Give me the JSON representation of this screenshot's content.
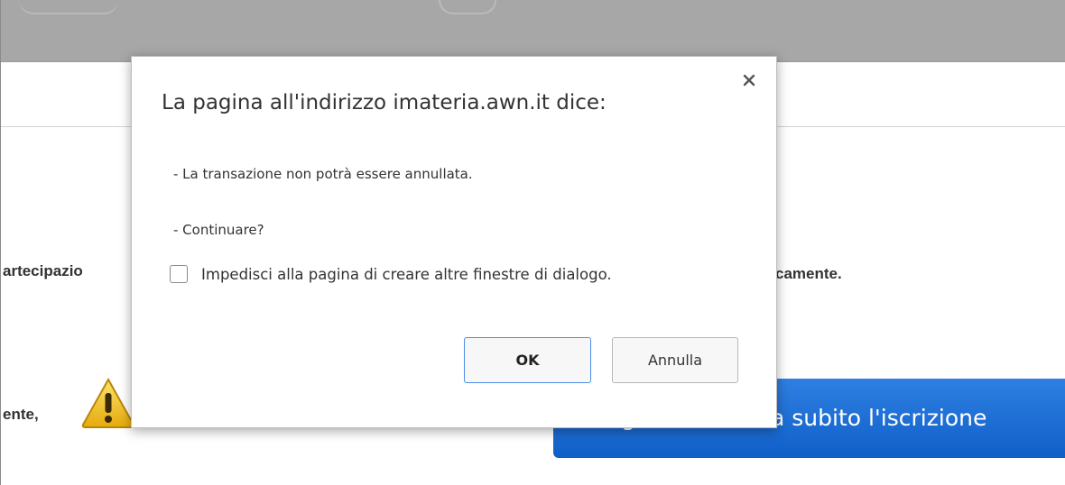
{
  "background": {
    "text_left_1": "artecipazio",
    "text_left_2": "ente,",
    "text_right_1": "camente.",
    "cta_label": "Paga e conferma subito l'iscrizione",
    "colors": {
      "top_bar": "#a7a7a7",
      "cta": "#1e6fd8",
      "warning": "#f2c21b"
    },
    "icons": [
      "warning-icon"
    ]
  },
  "dialog": {
    "title": "La pagina all'indirizzo imateria.awn.it dice:",
    "messages": [
      "- La transazione non potrà essere annullata.",
      "- Continuare?"
    ],
    "checkbox_label": "Impedisci alla pagina di creare altre finestre di dialogo.",
    "checkbox_checked": false,
    "ok_label": "OK",
    "cancel_label": "Annulla",
    "icons": [
      "close-icon"
    ],
    "colors": {
      "ok_border": "#4b8ee8"
    }
  }
}
